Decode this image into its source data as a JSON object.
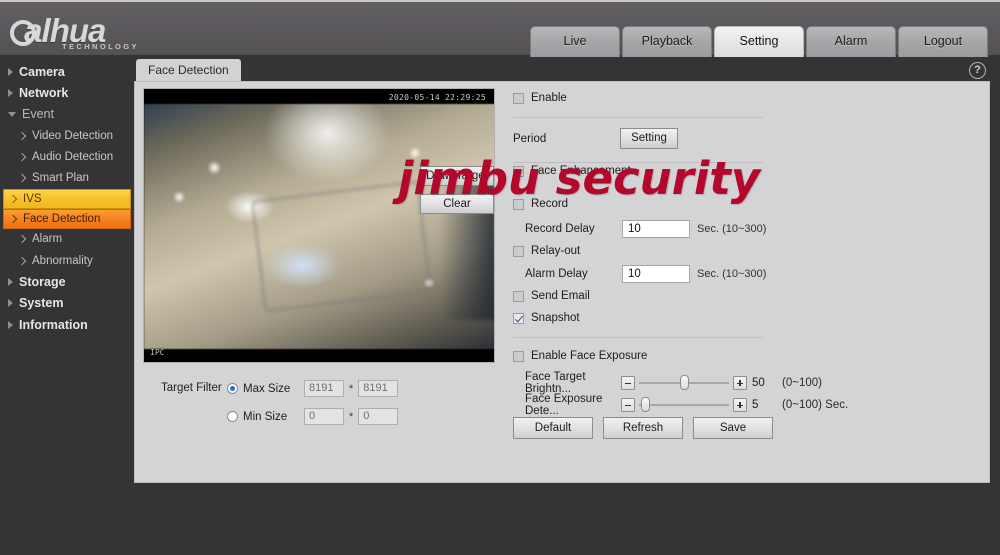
{
  "brand": {
    "name": "alhua",
    "tagline": "TECHNOLOGY"
  },
  "topnav": {
    "tabs": [
      {
        "label": "Live",
        "active": false
      },
      {
        "label": "Playback",
        "active": false
      },
      {
        "label": "Setting",
        "active": true
      },
      {
        "label": "Alarm",
        "active": false
      },
      {
        "label": "Logout",
        "active": false
      }
    ]
  },
  "sidebar": {
    "items": [
      {
        "label": "Camera",
        "level": "top",
        "state": "collapsed"
      },
      {
        "label": "Network",
        "level": "top",
        "state": "collapsed"
      },
      {
        "label": "Event",
        "level": "top",
        "state": "expanded"
      },
      {
        "label": "Video Detection",
        "level": "sub",
        "state": "normal"
      },
      {
        "label": "Audio Detection",
        "level": "sub",
        "state": "normal"
      },
      {
        "label": "Smart Plan",
        "level": "sub",
        "state": "normal"
      },
      {
        "label": "IVS",
        "level": "sub",
        "state": "hover"
      },
      {
        "label": "Face Detection",
        "level": "sub",
        "state": "selected"
      },
      {
        "label": "Alarm",
        "level": "sub",
        "state": "normal"
      },
      {
        "label": "Abnormality",
        "level": "sub",
        "state": "normal"
      },
      {
        "label": "Storage",
        "level": "top",
        "state": "collapsed"
      },
      {
        "label": "System",
        "level": "top",
        "state": "collapsed"
      },
      {
        "label": "Information",
        "level": "top",
        "state": "collapsed"
      }
    ]
  },
  "page": {
    "tab_label": "Face Detection",
    "help_glyph": "?"
  },
  "video": {
    "osd_time": "2020-05-14 22:29:25",
    "osd_channel": "IPC"
  },
  "target_filter": {
    "label": "Target Filter",
    "max_size": {
      "label": "Max Size",
      "selected": true,
      "width": "8191",
      "height": "8191",
      "separator": "*"
    },
    "min_size": {
      "label": "Min Size",
      "selected": false,
      "width": "0",
      "height": "0",
      "separator": "*"
    },
    "draw_target_label": "Draw Target",
    "clear_label": "Clear"
  },
  "form": {
    "enable": {
      "label": "Enable",
      "checked": false
    },
    "period": {
      "label": "Period",
      "button_label": "Setting"
    },
    "face_enhancement": {
      "label": "Face Enhancement",
      "checked": false
    },
    "record": {
      "label": "Record",
      "checked": false
    },
    "record_delay": {
      "label": "Record Delay",
      "value": "10",
      "hint": "Sec. (10~300)"
    },
    "relay_out": {
      "label": "Relay-out",
      "checked": false
    },
    "alarm_delay": {
      "label": "Alarm Delay",
      "value": "10",
      "hint": "Sec. (10~300)"
    },
    "send_email": {
      "label": "Send Email",
      "checked": false
    },
    "snapshot": {
      "label": "Snapshot",
      "checked": true
    },
    "enable_face_exposure": {
      "label": "Enable Face Exposure",
      "checked": false
    },
    "face_target_brightness": {
      "label": "Face Target Brightn...",
      "value": "50",
      "range_hint": "(0~100)",
      "min": 0,
      "max": 100,
      "minus_glyph": "−",
      "plus_glyph": "+"
    },
    "face_exposure_detection": {
      "label": "Face Exposure Dete...",
      "value": "5",
      "range_hint": "(0~100) Sec.",
      "min": 0,
      "max": 100,
      "minus_glyph": "−",
      "plus_glyph": "+"
    },
    "buttons": {
      "default_label": "Default",
      "refresh_label": "Refresh",
      "save_label": "Save"
    }
  },
  "watermark": {
    "text": "jimbu security",
    "color": "#b3082c"
  },
  "colors": {
    "header_bg": "#5a575b",
    "app_bg": "#343336",
    "panel_bg": "#d4d3d5",
    "accent_selected": "#f58020",
    "accent_hover": "#f7c02b"
  }
}
